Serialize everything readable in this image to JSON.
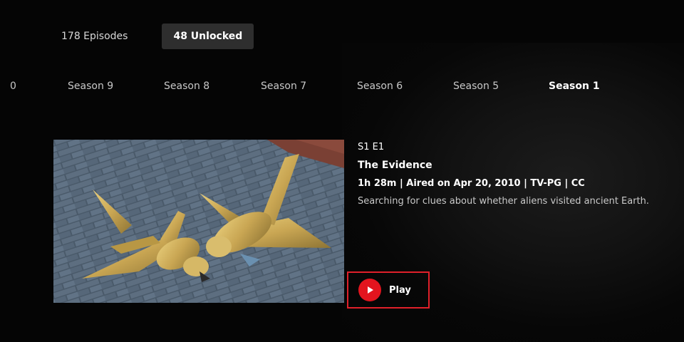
{
  "filters": [
    {
      "label": "178 Episodes",
      "active": false
    },
    {
      "label": "48 Unlocked",
      "active": true
    }
  ],
  "seasons": [
    "0",
    "Season 9",
    "Season 8",
    "Season 7",
    "Season 6",
    "Season 5",
    "Season 1"
  ],
  "active_season": "Season 1",
  "episode": {
    "code": "S1 E1",
    "title": "The Evidence",
    "meta": "1h 28m | Aired on Apr 20, 2010 | TV-PG | CC",
    "description": "Searching for clues about whether aliens visited ancient Earth.",
    "play_label": "Play"
  },
  "colors": {
    "accent": "#e3141e",
    "highlight_border": "#e0202a",
    "active_chip": "#2e2e2e"
  }
}
